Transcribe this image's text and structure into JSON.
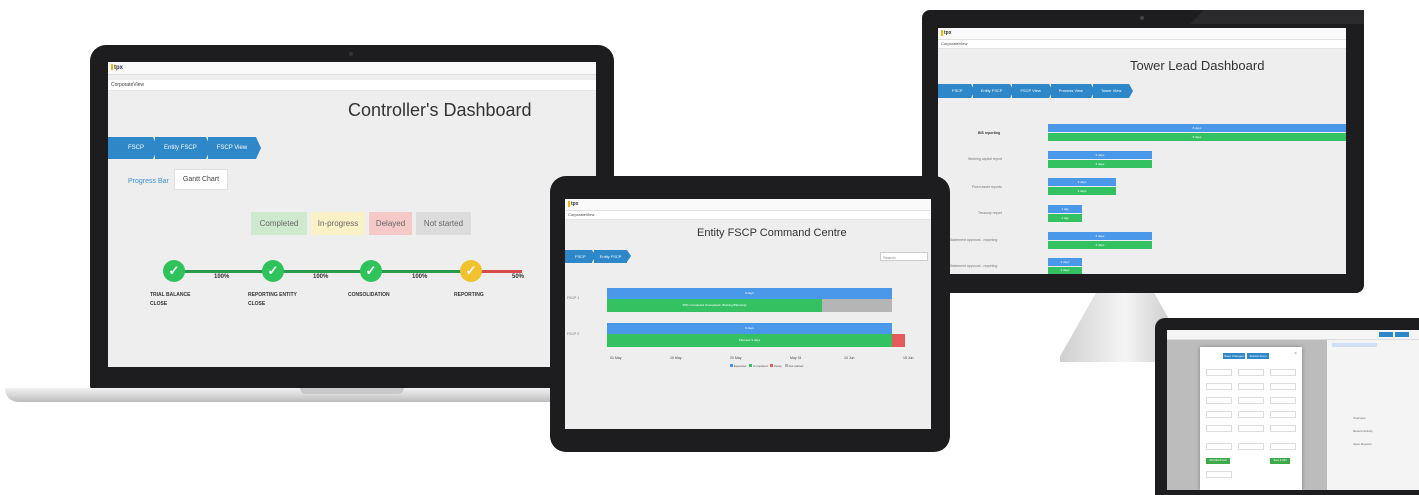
{
  "laptop": {
    "app_logo": "tpx",
    "tab": "CorporateView",
    "title": "Controller's Dashboard",
    "breadcrumbs": [
      "FSCP",
      "Entity FSCP",
      "FSCP View"
    ],
    "tabs": [
      "Progress Bar",
      "Gantt Chart"
    ],
    "legend": [
      "Completed",
      "In-progress",
      "Delayed",
      "Not started"
    ],
    "percentages": [
      "100%",
      "100%",
      "100%",
      "50%"
    ],
    "stages": [
      {
        "label": "TRIAL BALANCE CLOSE",
        "status": "completed"
      },
      {
        "label": "REPORTING ENTITY CLOSE",
        "status": "completed"
      },
      {
        "label": "CONSOLIDATION",
        "status": "completed"
      },
      {
        "label": "REPORTING",
        "status": "in-progress"
      }
    ],
    "check_glyph": "✓"
  },
  "tablet": {
    "app_logo": "tpx",
    "tab": "CorporateView",
    "title": "Entity FSCP Command Centre",
    "breadcrumbs": [
      "FSCP",
      "Entity FSCP"
    ],
    "search_placeholder": "Search",
    "rows": [
      "FSCP 1",
      "FSCP 2"
    ],
    "x_ticks": [
      "01 May",
      "10 May",
      "20 May",
      "May 31",
      "10 Jun",
      "15 Jun"
    ],
    "legend": [
      "Expected",
      "Completed",
      "Delay",
      "Not started"
    ],
    "bar_texts": [
      "8 days",
      "95% Completed (Completed: Working/Planning)",
      "8 days",
      "Planned: 9 days"
    ]
  },
  "monitor": {
    "app_logo": "tpx",
    "tab": "CorporateView",
    "title": "Tower Lead Dashboard",
    "breadcrumbs": [
      "FSCP",
      "Entity FSCP",
      "FSCP View",
      "Process View",
      "Tower View"
    ],
    "rows": [
      "BIS reporting",
      "Working capital report",
      "Fixed asset reports",
      "Treasury report",
      "Statement approval - reporting",
      "Statement approval - reporting"
    ],
    "bar_texts": [
      "8 days",
      "8 days",
      "5 days",
      "5 days",
      "3 days",
      "3 days",
      "1 day",
      "1 day",
      "6 days",
      "6 days",
      "2 days",
      "2 days"
    ]
  },
  "small_tablet": {
    "tabs": [
      "Save Changes",
      "Submit Form"
    ],
    "side_items": [
      "Overview",
      "Recent Activity",
      "Open Reports"
    ],
    "buttons": [
      "Add Attachment",
      "Save & Add"
    ]
  },
  "colors": {
    "blue": "#2d87c8",
    "bar_blue": "#4a98ea",
    "green": "#2ec45b",
    "gantt_green": "#33c161",
    "yellow": "#f2c12e",
    "red": "#e45b5b",
    "grey": "#b5b5b5"
  }
}
